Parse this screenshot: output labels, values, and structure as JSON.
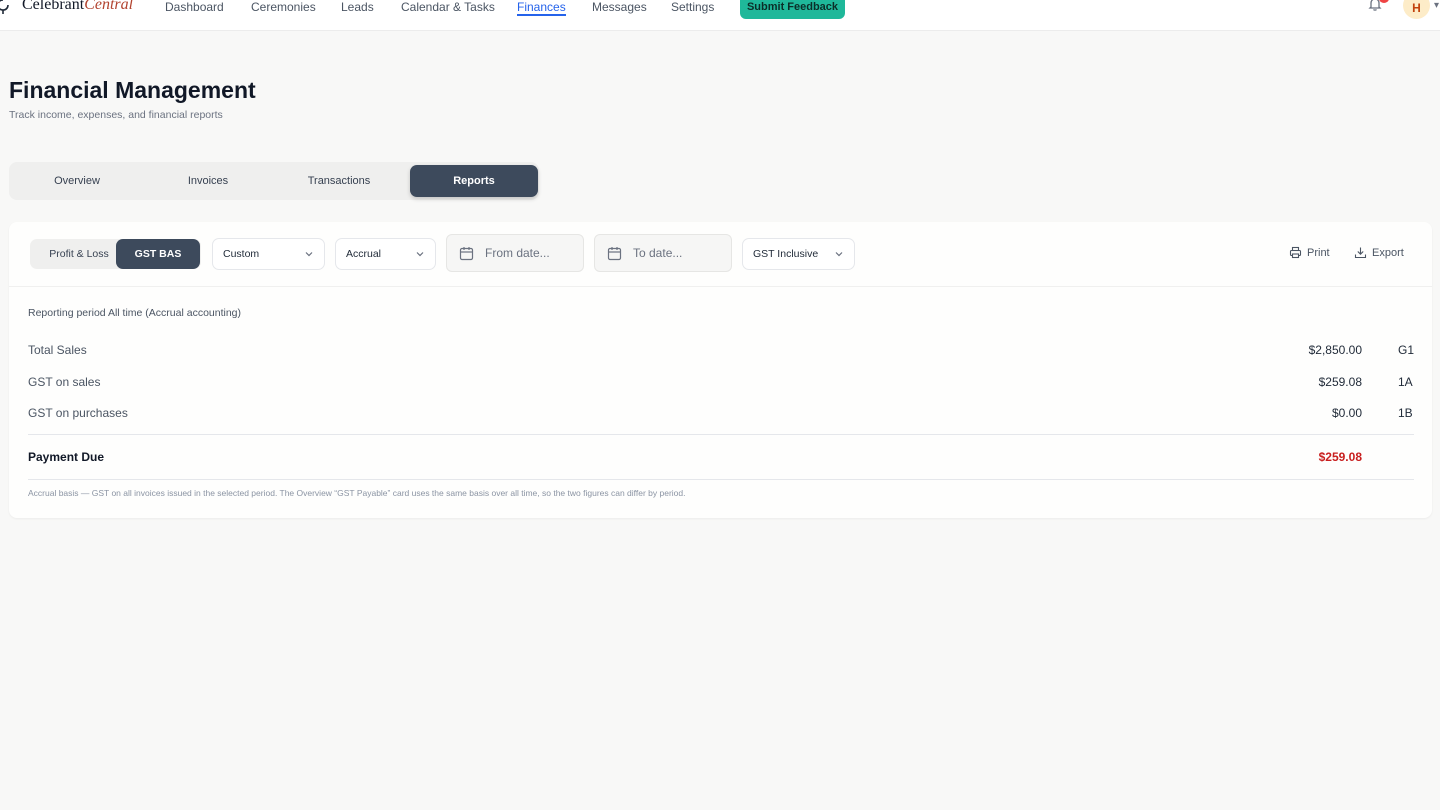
{
  "nav": {
    "brand_main": "Celebrant",
    "brand_accent": "Central",
    "items": [
      {
        "label": "Dashboard"
      },
      {
        "label": "Ceremonies"
      },
      {
        "label": "Leads"
      },
      {
        "label": "Calendar & Tasks"
      },
      {
        "label": "Finances",
        "active": true
      },
      {
        "label": "Messages"
      },
      {
        "label": "Settings"
      }
    ],
    "feedback_label": "Submit Feedback",
    "avatar_initial": "H"
  },
  "page": {
    "title": "Financial Management",
    "subtitle": "Track income, expenses, and financial reports"
  },
  "tabs": [
    {
      "label": "Overview"
    },
    {
      "label": "Invoices"
    },
    {
      "label": "Transactions"
    },
    {
      "label": "Reports",
      "active": true
    }
  ],
  "report": {
    "toggle": {
      "pl_label": "Profit & Loss",
      "gst_label": "GST BAS",
      "active": "GST BAS"
    },
    "period_select": "Custom",
    "basis_select": "Accrual",
    "from_placeholder": "From date...",
    "to_placeholder": "To date...",
    "gst_select": "GST Inclusive",
    "print_label": "Print",
    "export_label": "Export",
    "period_text": "Reporting period All time (Accrual accounting)",
    "rows": [
      {
        "label": "Total Sales",
        "value": "$2,850.00",
        "code": "G1"
      },
      {
        "label": "GST on sales",
        "value": "$259.08",
        "code": "1A"
      },
      {
        "label": "GST on purchases",
        "value": "$0.00",
        "code": "1B"
      }
    ],
    "payment_due_label": "Payment Due",
    "payment_due_value": "$259.08",
    "note": "Accrual basis — GST on all invoices issued in the selected period. The Overview “GST Payable” card uses the same basis over all time, so the two figures can differ by period."
  },
  "colors": {
    "accent": "#1fb89a",
    "active_tab": "#3d4a5c",
    "link": "#2563eb",
    "due": "#c81e1e"
  }
}
